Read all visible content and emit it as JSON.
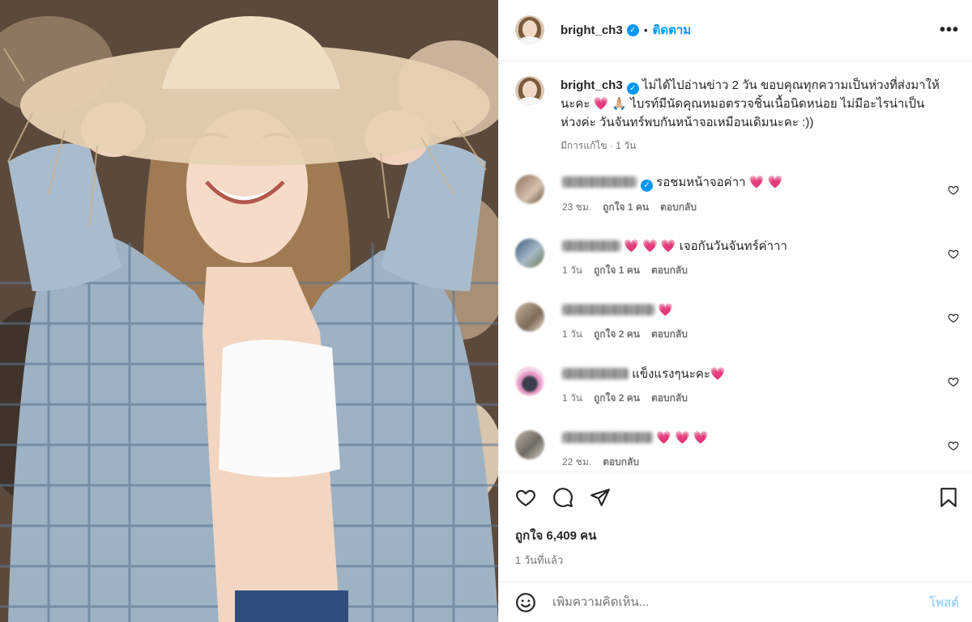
{
  "post": {
    "username": "bright_ch3",
    "verified": true,
    "follow_label": "ติดตาม",
    "more_label": "•••",
    "caption_line": "ไม่ได้ไปอ่านข่าว 2 วัน ขอบคุณทุกความเป็นห่วงที่ส่งมาให้นะคะ 💗 🙏🏼 ไบรท์มีนัดคุณหมอตรวจชิ้นเนื้อนิดหน่อย ไม่มีอะไรน่าเป็นห่วงค่ะ วันจันทร์พบกันหน้าจอเหมือนเดิมนะคะ :))",
    "caption_meta": "มีการแก้ไข · 1 วัน"
  },
  "comments": [
    {
      "text": "รอชมหน้าจอค่าา 💗 💗",
      "time": "23 ชม.",
      "likes": "ถูกใจ 1 คน",
      "reply": "ตอบกลับ",
      "verified": true
    },
    {
      "text": "💗 💗 💗 เจอกันวันจันทร์ค่าาา",
      "time": "1 วัน",
      "likes": "ถูกใจ 1 คน",
      "reply": "ตอบกลับ",
      "verified": false
    },
    {
      "text": "💗",
      "time": "1 วัน",
      "likes": "ถูกใจ 2 คน",
      "reply": "ตอบกลับ",
      "verified": false
    },
    {
      "text": "แข็งแรงๆนะคะ💗",
      "time": "1 วัน",
      "likes": "ถูกใจ 2 คน",
      "reply": "ตอบกลับ",
      "verified": false
    },
    {
      "text": "💗 💗 💗",
      "time": "22 ชม.",
      "likes": "",
      "reply": "ตอบกลับ",
      "verified": false
    }
  ],
  "stats": {
    "likes": "ถูกใจ 6,409 คน",
    "posted": "1 วันที่แล้ว"
  },
  "composer": {
    "placeholder": "เพิ่มความคิดเห็น...",
    "post_label": "โพสต์"
  },
  "colors": {
    "accent": "#0095f6",
    "post_disabled": "#a7d7fa",
    "heart": "#e8245c"
  },
  "icons": [
    "heart-icon",
    "comment-icon",
    "share-icon",
    "bookmark-icon",
    "emoji-icon",
    "more-icon"
  ]
}
